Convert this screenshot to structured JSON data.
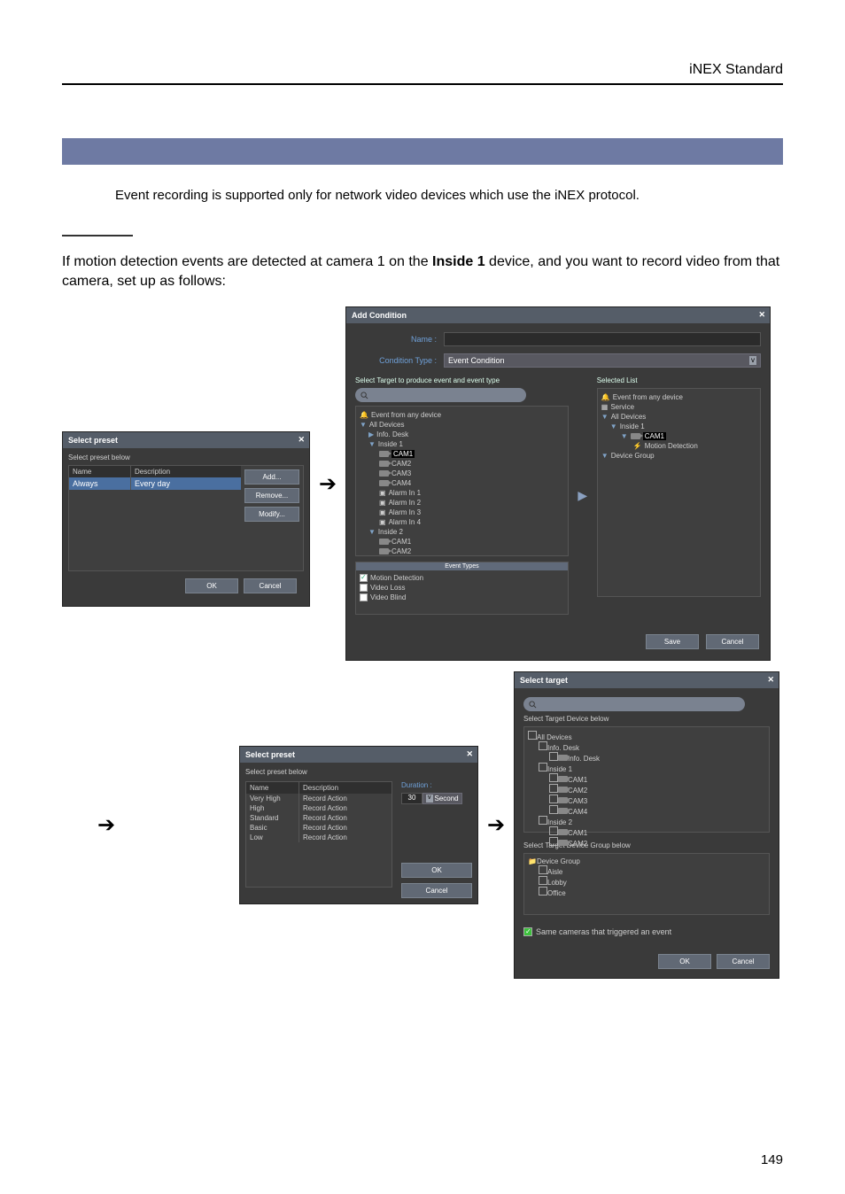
{
  "header": {
    "product": "iNEX Standard"
  },
  "note": "Event recording is supported only for network video devices which use the iNEX protocol.",
  "example_intro_pre": "If motion detection events are detected at camera 1 on the ",
  "example_intro_bold": "Inside 1",
  "example_intro_post": " device, and you want to record video from that camera, set up as follows:",
  "preset1": {
    "title": "Select preset",
    "sub": "Select preset below",
    "cols": {
      "name": "Name",
      "desc": "Description"
    },
    "row": {
      "name": "Always",
      "desc": "Every day"
    },
    "buttons": {
      "add": "Add...",
      "remove": "Remove...",
      "modify": "Modify..."
    },
    "ok": "OK",
    "cancel": "Cancel"
  },
  "addcond": {
    "title": "Add Condition",
    "name_label": "Name :",
    "type_label": "Condition Type :",
    "type_value": "Event Condition",
    "lcol_head": "Select Target to produce event and event type",
    "rcol_head": "Selected List",
    "tree_left": {
      "any": "Event from any device",
      "all": "All Devices",
      "info_desk": "Info. Desk",
      "inside1": "Inside 1",
      "cam1": "CAM1",
      "cam2": "CAM2",
      "cam3": "CAM3",
      "cam4": "CAM4",
      "alarm1": "Alarm In 1",
      "alarm2": "Alarm In 2",
      "alarm3": "Alarm In 3",
      "alarm4": "Alarm In 4",
      "inside2": "Inside 2"
    },
    "events": {
      "head": "Event Types",
      "motion": "Motion Detection",
      "vloss": "Video Loss",
      "vblind": "Video Blind"
    },
    "tree_right": {
      "any": "Event from any device",
      "service": "Service",
      "all": "All Devices",
      "inside1": "Inside 1",
      "cam1": "CAM1",
      "motion": "Motion Detection",
      "devgroup": "Device Group"
    },
    "save": "Save",
    "cancel": "Cancel"
  },
  "preset2": {
    "title": "Select preset",
    "sub": "Select preset below",
    "cols": {
      "name": "Name",
      "desc": "Description"
    },
    "rows": [
      {
        "name": "Very High",
        "desc": "Record Action"
      },
      {
        "name": "High",
        "desc": "Record Action"
      },
      {
        "name": "Standard",
        "desc": "Record Action"
      },
      {
        "name": "Basic",
        "desc": "Record Action"
      },
      {
        "name": "Low",
        "desc": "Record Action"
      }
    ],
    "duration_label": "Duration :",
    "duration_value": "30",
    "duration_unit": "Second",
    "ok": "OK",
    "cancel": "Cancel"
  },
  "seltarget": {
    "title": "Select target",
    "sub1": "Select Target Device below",
    "tree": {
      "all": "All Devices",
      "info_desk": "Info. Desk",
      "info_desk2": "Info. Desk",
      "inside1": "Inside 1",
      "cam1": "CAM1",
      "cam2": "CAM2",
      "cam3": "CAM3",
      "cam4": "CAM4",
      "inside2": "Inside 2",
      "i2cam1": "CAM1",
      "i2cam2": "CAM2"
    },
    "sub2": "Select Target Device Group below",
    "groups": {
      "devgroup": "Device Group",
      "aisle": "Aisle",
      "lobby": "Lobby",
      "office": "Office"
    },
    "same_checkbox": "Same cameras that triggered an event",
    "ok": "OK",
    "cancel": "Cancel"
  },
  "page_number": "149"
}
